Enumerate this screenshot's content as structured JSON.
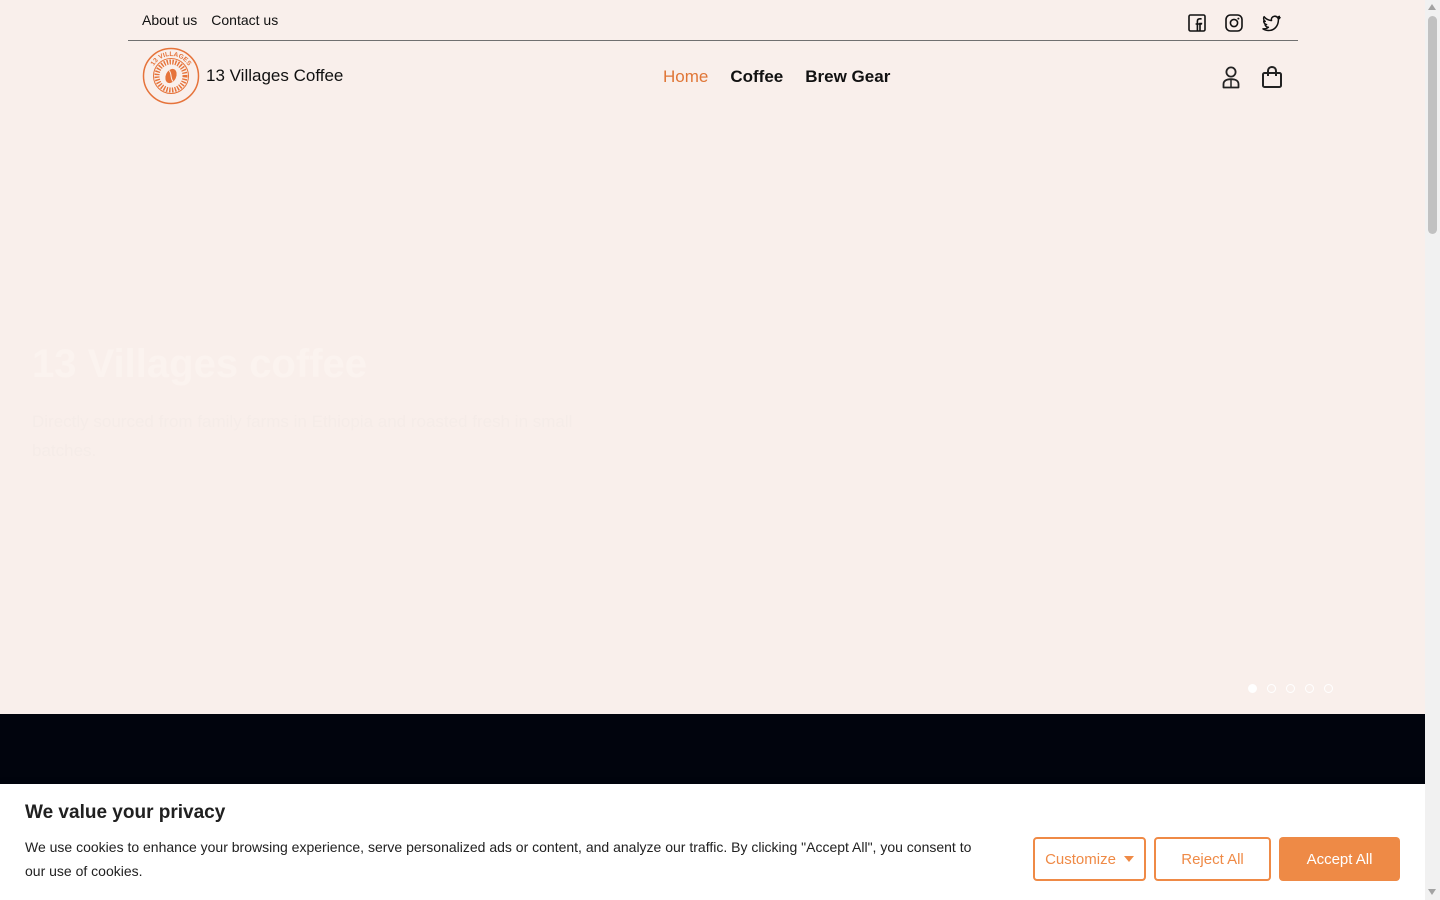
{
  "topbar": {
    "links": [
      "About us",
      "Contact us"
    ],
    "social_icons": [
      "facebook-icon",
      "instagram-icon",
      "twitter-icon"
    ]
  },
  "header": {
    "brand_name": "13 Villages Coffee",
    "logo_text": "13 VILLAGES",
    "nav": [
      {
        "label": "Home",
        "active": true
      },
      {
        "label": "Coffee",
        "active": false
      },
      {
        "label": "Brew Gear",
        "active": false
      }
    ],
    "icons": [
      "account-icon",
      "cart-icon"
    ]
  },
  "hero": {
    "title": "13 Villages coffee",
    "subtitle": "Directly sourced from family farms in Ethiopia and roasted fresh in small batches."
  },
  "carousel": {
    "slide_count": 5,
    "active_index": 0
  },
  "cookie_banner": {
    "title": "We value your privacy",
    "text": "We use cookies to enhance your browsing experience, serve personalized ads or content, and analyze our traffic. By clicking \"Accept All\", you consent to our use of cookies.",
    "customize_label": "Customize",
    "reject_label": "Reject All",
    "accept_label": "Accept All"
  },
  "colors": {
    "accent": "#e07637",
    "button_orange": "#ee8a46",
    "hero_bg": "#f9efeb",
    "dark_band": "#01040d"
  }
}
